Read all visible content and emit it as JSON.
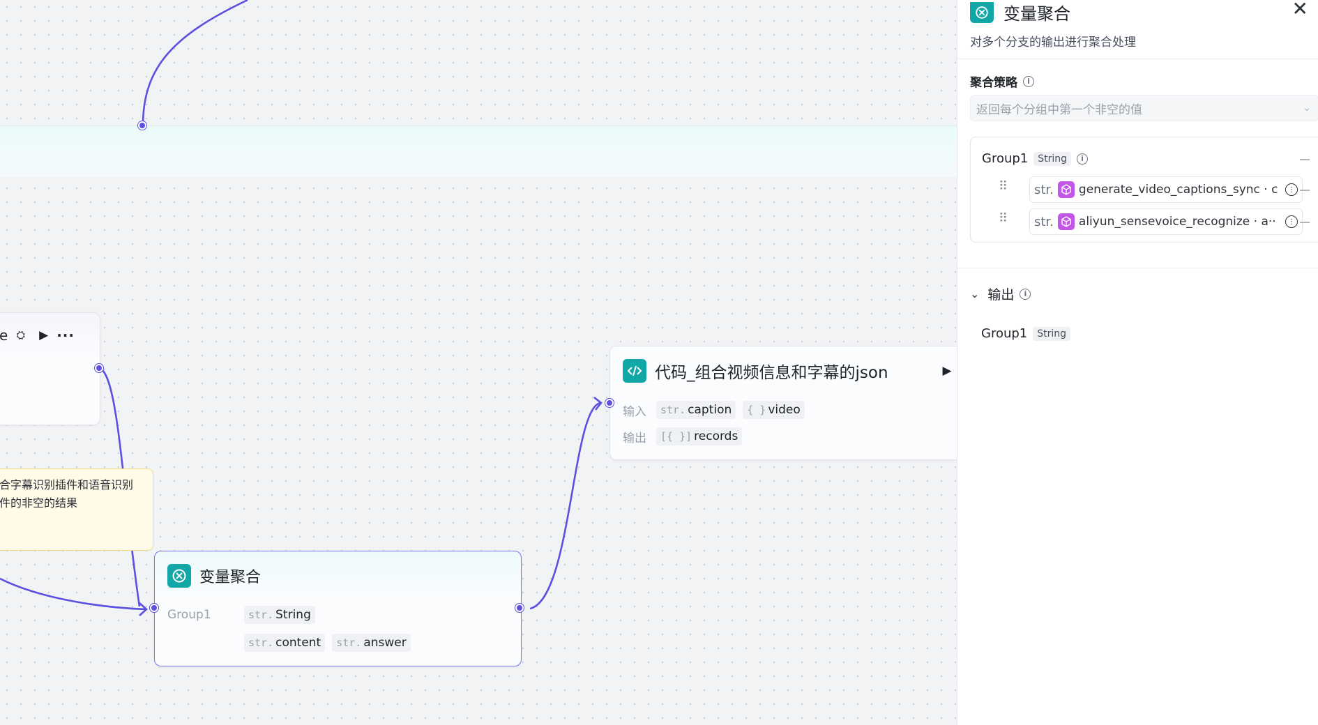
{
  "canvas": {
    "partial_node": {
      "title_tail": "e",
      "run_icon": "play-icon",
      "more_icon": "more-icon"
    },
    "note": {
      "line1": "合字幕识别插件和语音识别",
      "line2": "件的非空的结果"
    },
    "code_node": {
      "title": "代码_组合视频信息和字幕的json",
      "input_label": "输入",
      "output_label": "输出",
      "inputs": [
        {
          "type": "str.",
          "name": "caption"
        },
        {
          "type": "{ }",
          "name": "video"
        }
      ],
      "outputs": [
        {
          "type": "[{ }]",
          "name": "records"
        }
      ]
    },
    "agg_node": {
      "title": "变量聚合",
      "group_label": "Group1",
      "group_type_prefix": "str.",
      "group_type": "String",
      "vars": [
        {
          "type": "str.",
          "name": "content"
        },
        {
          "type": "str.",
          "name": "answer"
        }
      ]
    }
  },
  "panel": {
    "title": "变量聚合",
    "description": "对多个分支的输出进行聚合处理",
    "strategy_label": "聚合策略",
    "strategy_value": "返回每个分组中第一个非空的值",
    "group": {
      "name": "Group1",
      "type": "String",
      "rows": [
        {
          "type": "str.",
          "text": "generate_video_captions_sync · c"
        },
        {
          "type": "str.",
          "text": "aliyun_sensevoice_recognize · a··"
        }
      ]
    },
    "output_section": {
      "label": "输出",
      "group_name": "Group1",
      "group_type": "String"
    }
  },
  "colors": {
    "accent": "#5b50e0",
    "node_icon": "#12a7a7",
    "plugin_icon": "#c355e8",
    "note_bg": "#fffbe8"
  }
}
